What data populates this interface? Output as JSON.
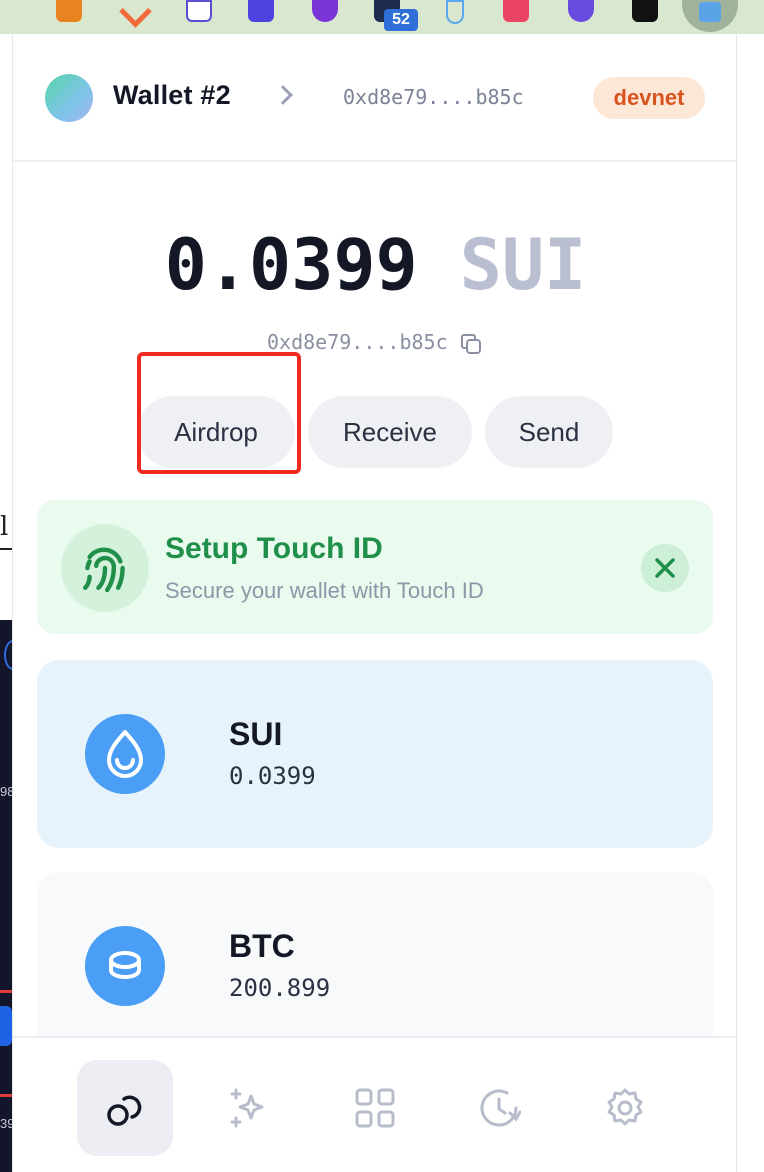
{
  "browser": {
    "extensions": [
      {
        "name": "metamask-extension"
      },
      {
        "name": "arrow-extension"
      },
      {
        "name": "cube-extension"
      },
      {
        "name": "k-extension"
      },
      {
        "name": "globe-extension"
      },
      {
        "name": "badge-extension",
        "badge": "52"
      },
      {
        "name": "drop-extension"
      },
      {
        "name": "p-extension"
      },
      {
        "name": "shield-extension"
      },
      {
        "name": "okx-extension"
      },
      {
        "name": "wallet-extension-active"
      }
    ]
  },
  "background": {
    "partial_text": "l",
    "edge_numbers": [
      "98",
      "39"
    ]
  },
  "header": {
    "wallet_name": "Wallet #2",
    "address": "0xd8e79....b85c",
    "network": "devnet"
  },
  "balance": {
    "amount": "0.0399",
    "symbol": "SUI",
    "address": "0xd8e79....b85c"
  },
  "actions": {
    "airdrop": "Airdrop",
    "receive": "Receive",
    "send": "Send"
  },
  "touch_id": {
    "title": "Setup Touch ID",
    "description": "Secure your wallet with Touch ID"
  },
  "tokens": [
    {
      "symbol": "SUI",
      "balance": "0.0399",
      "icon": "sui-drop-icon"
    },
    {
      "symbol": "BTC",
      "balance": "200.899",
      "icon": "coin-stack-icon"
    }
  ],
  "nav": [
    {
      "name": "home",
      "icon": "home-rings-icon",
      "active": true
    },
    {
      "name": "discover",
      "icon": "sparkles-icon",
      "active": false
    },
    {
      "name": "apps",
      "icon": "grid-icon",
      "active": false
    },
    {
      "name": "history",
      "icon": "history-icon",
      "active": false
    },
    {
      "name": "settings",
      "icon": "gear-icon",
      "active": false
    }
  ],
  "colors": {
    "accent_blue": "#4b9ef5",
    "highlight": "#ee2b1e",
    "touch_green": "#1f8f4a",
    "network_orange": "#d8541f"
  }
}
